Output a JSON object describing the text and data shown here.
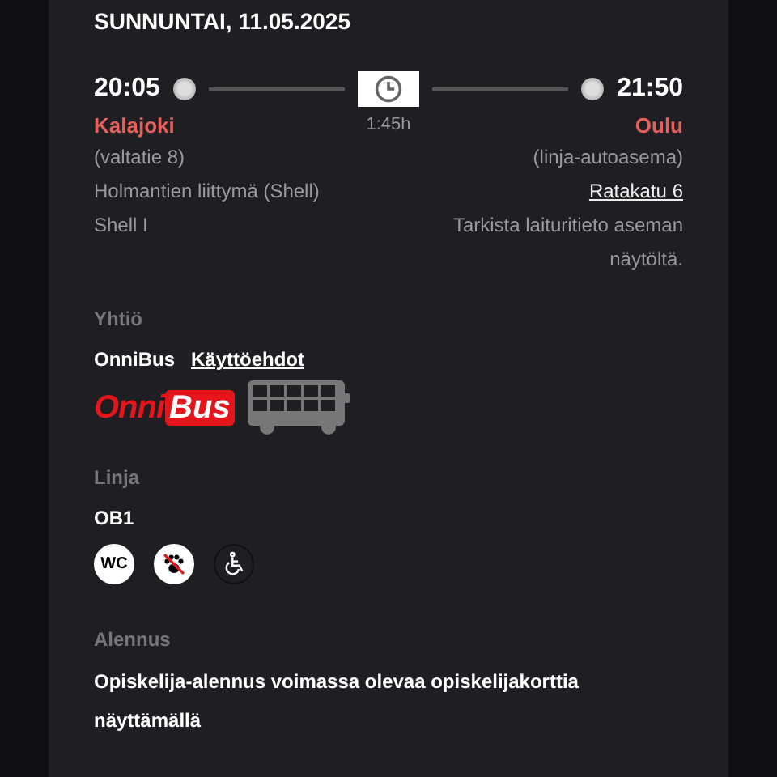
{
  "date": "SUNNUNTAI, 11.05.2025",
  "departure": {
    "time": "20:05",
    "city": "Kalajoki",
    "details": [
      "(valtatie 8)",
      "Holmantien liittymä (Shell)",
      "Shell I"
    ]
  },
  "duration": "1:45h",
  "arrival": {
    "time": "21:50",
    "city": "Oulu",
    "details": [
      {
        "text": "(linja-autoasema)",
        "link": false
      },
      {
        "text": "Ratakatu 6",
        "link": true
      },
      {
        "text": "Tarkista laituritieto aseman näytöltä.",
        "link": false
      }
    ]
  },
  "company": {
    "heading": "Yhtiö",
    "name": "OnniBus",
    "terms_link": "Käyttöehdot",
    "logo": {
      "part_1": "Onni",
      "part_2": "Bus"
    }
  },
  "line": {
    "heading": "Linja",
    "code": "OB1",
    "amenities": [
      {
        "kind": "wc",
        "label": "WC",
        "available": true
      },
      {
        "kind": "pets",
        "available": true
      },
      {
        "kind": "wheelchair",
        "available": false
      }
    ]
  },
  "discount": {
    "heading": "Alennus",
    "text": "Opiskelija-alennus voimassa olevaa opiskelijakorttia näyttämällä"
  }
}
